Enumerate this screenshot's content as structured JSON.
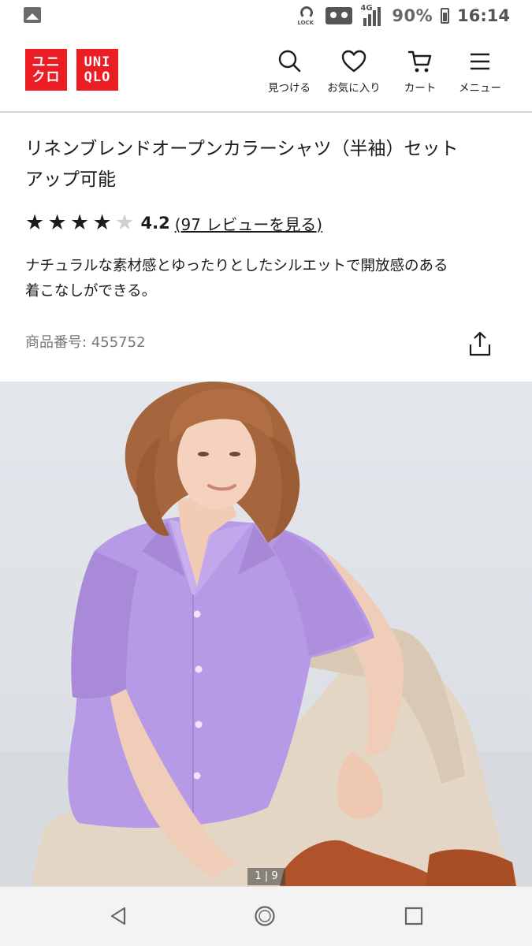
{
  "status_bar": {
    "battery_percent": "90%",
    "time": "16:14",
    "network": "4G",
    "lock_text": "LOCK"
  },
  "header": {
    "logo_lines": [
      "ユニ",
      "クロ",
      "UNI",
      "QLO"
    ],
    "nav": [
      {
        "label": "見つける",
        "icon": "search-icon"
      },
      {
        "label": "お気に入り",
        "icon": "heart-icon"
      },
      {
        "label": "カート",
        "icon": "cart-icon"
      },
      {
        "label": "メニュー",
        "icon": "menu-icon"
      }
    ]
  },
  "product": {
    "title_line1": "リネンブレンドオープンカラーシャツ（半袖）セット",
    "title_line2": "アップ可能",
    "rating": "4.2",
    "rating_value": 4.2,
    "stars_total": 5,
    "reviews_link": "(97 レビューを見る)",
    "description_line1": "ナチュラルな素材感とゆったりとしたシルエットで開放感のある",
    "description_line2": "着こなしができる。",
    "product_no_label": "商品番号:",
    "product_no": "455752"
  },
  "gallery": {
    "counter": "1 | 9",
    "current": 1,
    "total": 9
  },
  "colors": {
    "brand_red": "#ed1d24",
    "shirt_lavender": "#b79ae6"
  }
}
